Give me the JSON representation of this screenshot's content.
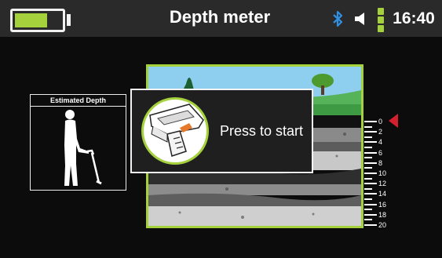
{
  "header": {
    "title": "Depth meter",
    "time": "16:40",
    "battery_level": 0.7,
    "icons": [
      "battery-icon",
      "bluetooth-icon",
      "speaker-icon",
      "signal-strength-icon"
    ],
    "signal_bars": 3
  },
  "depth_panel": {
    "title": "Estimated Depth",
    "figure": "person-with-detector-icon"
  },
  "depth_scale": {
    "labels": [
      "0",
      "2",
      "4",
      "6",
      "8",
      "10",
      "12",
      "14",
      "16",
      "18",
      "20"
    ],
    "marker_value": "0"
  },
  "popup": {
    "label": "Press to start",
    "icon": "detector-device-icon"
  },
  "colors": {
    "accent": "#a5d23c",
    "marker": "#d4202c",
    "sky": "#8ecff0",
    "grass": "#3f9a44"
  }
}
